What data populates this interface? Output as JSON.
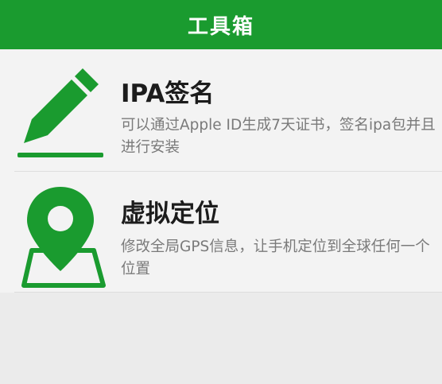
{
  "header": {
    "title": "工具箱"
  },
  "colors": {
    "accent": "#1a9b2f",
    "background": "#ebebeb",
    "card": "#f3f3f3"
  },
  "tools": [
    {
      "icon": "pencil-sign-icon",
      "title": "IPA签名",
      "description": "可以通过Apple ID生成7天证书，签名ipa包并且进行安装"
    },
    {
      "icon": "map-pin-icon",
      "title": "虚拟定位",
      "description": "修改全局GPS信息，让手机定位到全球任何一个位置"
    }
  ]
}
